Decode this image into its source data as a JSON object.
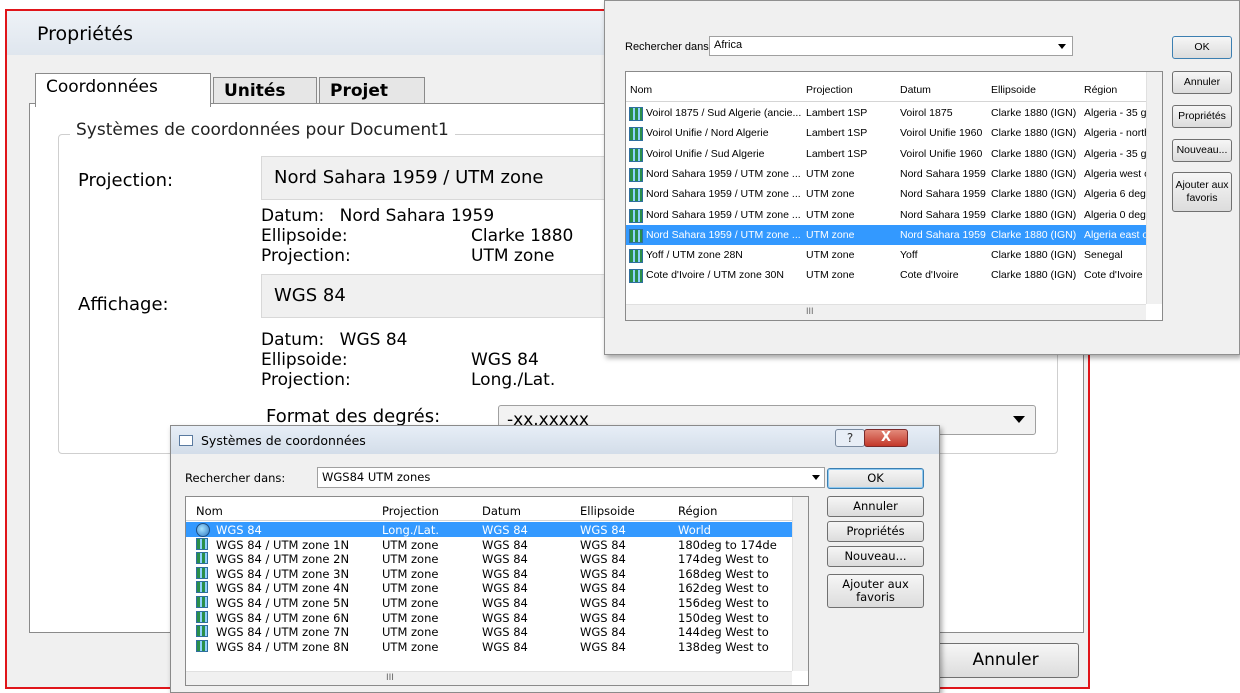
{
  "main": {
    "title": "Propriétés",
    "tabs": [
      "Coordonnées",
      "Unités",
      "Projet"
    ],
    "group_title": "Systèmes de coordonnées pour Document1",
    "projection_label": "Projection:",
    "projection_value": "Nord Sahara 1959 / UTM zone",
    "proj_info": {
      "datum_label": "Datum:",
      "datum_value": "Nord Sahara 1959",
      "ellipsoid_label": "Ellipsoide:",
      "ellipsoid_value": "Clarke 1880",
      "projection_label": "Projection:",
      "projection_value": "UTM zone"
    },
    "display_label": "Affichage:",
    "display_value": "WGS 84",
    "disp_info": {
      "datum_label": "Datum:",
      "datum_value": "WGS 84",
      "ellipsoid_label": "Ellipsoide:",
      "ellipsoid_value": "WGS 84",
      "projection_label": "Projection:",
      "projection_value": "Long./Lat."
    },
    "degree_format_label": "Format des degrés:",
    "degree_format_value": "-xx.xxxxx",
    "cancel_label": "Annuler"
  },
  "top_dialog": {
    "search_label": "Rechercher dans:",
    "search_value": "Africa",
    "columns": [
      "Nom",
      "Projection",
      "Datum",
      "Ellipsoide",
      "Région"
    ],
    "rows": [
      [
        "Voirol 1875 / Sud Algerie (ancie...",
        "Lambert 1SP",
        "Voirol 1875",
        "Clarke 1880 (IGN)",
        "Algeria - 35 gr"
      ],
      [
        "Voirol Unifie / Nord Algerie",
        "Lambert 1SP",
        "Voirol Unifie 1960",
        "Clarke 1880 (IGN)",
        "Algeria - north"
      ],
      [
        "Voirol Unifie / Sud Algerie",
        "Lambert 1SP",
        "Voirol Unifie 1960",
        "Clarke 1880 (IGN)",
        "Algeria - 35 gr"
      ],
      [
        "Nord Sahara 1959 / UTM zone ...",
        "UTM zone",
        "Nord Sahara 1959",
        "Clarke 1880 (IGN)",
        "Algeria west o"
      ],
      [
        "Nord Sahara 1959 / UTM zone ...",
        "UTM zone",
        "Nord Sahara 1959",
        "Clarke 1880 (IGN)",
        "Algeria 6 deg"
      ],
      [
        "Nord Sahara 1959 / UTM zone ...",
        "UTM zone",
        "Nord Sahara 1959",
        "Clarke 1880 (IGN)",
        "Algeria 0 deg"
      ],
      [
        "Nord Sahara 1959 / UTM zone ...",
        "UTM zone",
        "Nord Sahara 1959",
        "Clarke 1880 (IGN)",
        "Algeria east o"
      ],
      [
        "Yoff / UTM zone 28N",
        "UTM zone",
        "Yoff",
        "Clarke 1880 (IGN)",
        "Senegal"
      ],
      [
        "Cote d'Ivoire / UTM zone 30N",
        "UTM zone",
        "Cote d'Ivoire",
        "Clarke 1880 (IGN)",
        "Cote d'Ivoire"
      ]
    ],
    "selected_row": 6,
    "hscroll_thumb": "III",
    "buttons": {
      "ok": "OK",
      "cancel": "Annuler",
      "props": "Propriétés",
      "new": "Nouveau...",
      "fav": "Ajouter aux favoris"
    }
  },
  "bottom_dialog": {
    "title": "Systèmes de coordonnées",
    "help": "?",
    "close": "X",
    "search_label": "Rechercher dans:",
    "search_value": "WGS84 UTM zones",
    "columns": [
      "Nom",
      "Projection",
      "Datum",
      "Ellipsoide",
      "Région"
    ],
    "rows": [
      [
        "WGS 84",
        "Long./Lat.",
        "WGS 84",
        "WGS 84",
        "World"
      ],
      [
        "WGS 84 / UTM zone 1N",
        "UTM zone",
        "WGS 84",
        "WGS 84",
        "180deg to 174de"
      ],
      [
        "WGS 84 / UTM zone 2N",
        "UTM zone",
        "WGS 84",
        "WGS 84",
        "174deg West to"
      ],
      [
        "WGS 84 / UTM zone 3N",
        "UTM zone",
        "WGS 84",
        "WGS 84",
        "168deg West to"
      ],
      [
        "WGS 84 / UTM zone 4N",
        "UTM zone",
        "WGS 84",
        "WGS 84",
        "162deg West to"
      ],
      [
        "WGS 84 / UTM zone 5N",
        "UTM zone",
        "WGS 84",
        "WGS 84",
        "156deg West to"
      ],
      [
        "WGS 84 / UTM zone 6N",
        "UTM zone",
        "WGS 84",
        "WGS 84",
        "150deg West to"
      ],
      [
        "WGS 84 / UTM zone 7N",
        "UTM zone",
        "WGS 84",
        "WGS 84",
        "144deg West to"
      ],
      [
        "WGS 84 / UTM zone 8N",
        "UTM zone",
        "WGS 84",
        "WGS 84",
        "138deg West to"
      ]
    ],
    "selected_row": 0,
    "hscroll_thumb": "III",
    "buttons": {
      "ok": "OK",
      "cancel": "Annuler",
      "props": "Propriétés",
      "new": "Nouveau...",
      "fav": "Ajouter aux favoris"
    }
  }
}
